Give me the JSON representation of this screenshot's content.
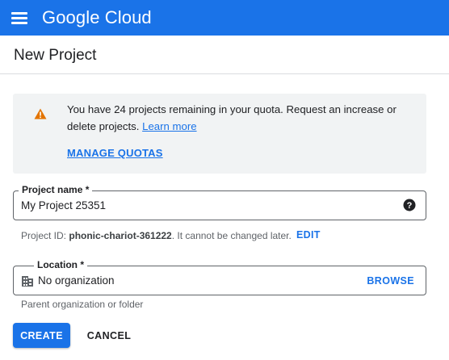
{
  "topbar": {
    "menu_icon": "hamburger-menu-icon",
    "brand_google": "Google",
    "brand_cloud": "Cloud",
    "color": "#1a73e8"
  },
  "page": {
    "title": "New Project"
  },
  "quota": {
    "icon": "warning-icon",
    "warning_color": "#e37400",
    "message": "You have 24 projects remaining in your quota. Request an increase or delete projects.",
    "learn_more": "Learn more",
    "manage_quotas": "MANAGE QUOTAS"
  },
  "project_name": {
    "label": "Project name *",
    "value": "My Project 25351",
    "help_icon": "help-circle-icon"
  },
  "project_id": {
    "prefix": "Project ID:",
    "id": "phonic-chariot-361222",
    "suffix": ". It cannot be changed later.",
    "edit": "EDIT"
  },
  "location": {
    "label": "Location *",
    "icon": "organization-building-icon",
    "value": "No organization",
    "browse": "BROWSE",
    "hint": "Parent organization or folder"
  },
  "actions": {
    "create": "CREATE",
    "cancel": "CANCEL"
  }
}
